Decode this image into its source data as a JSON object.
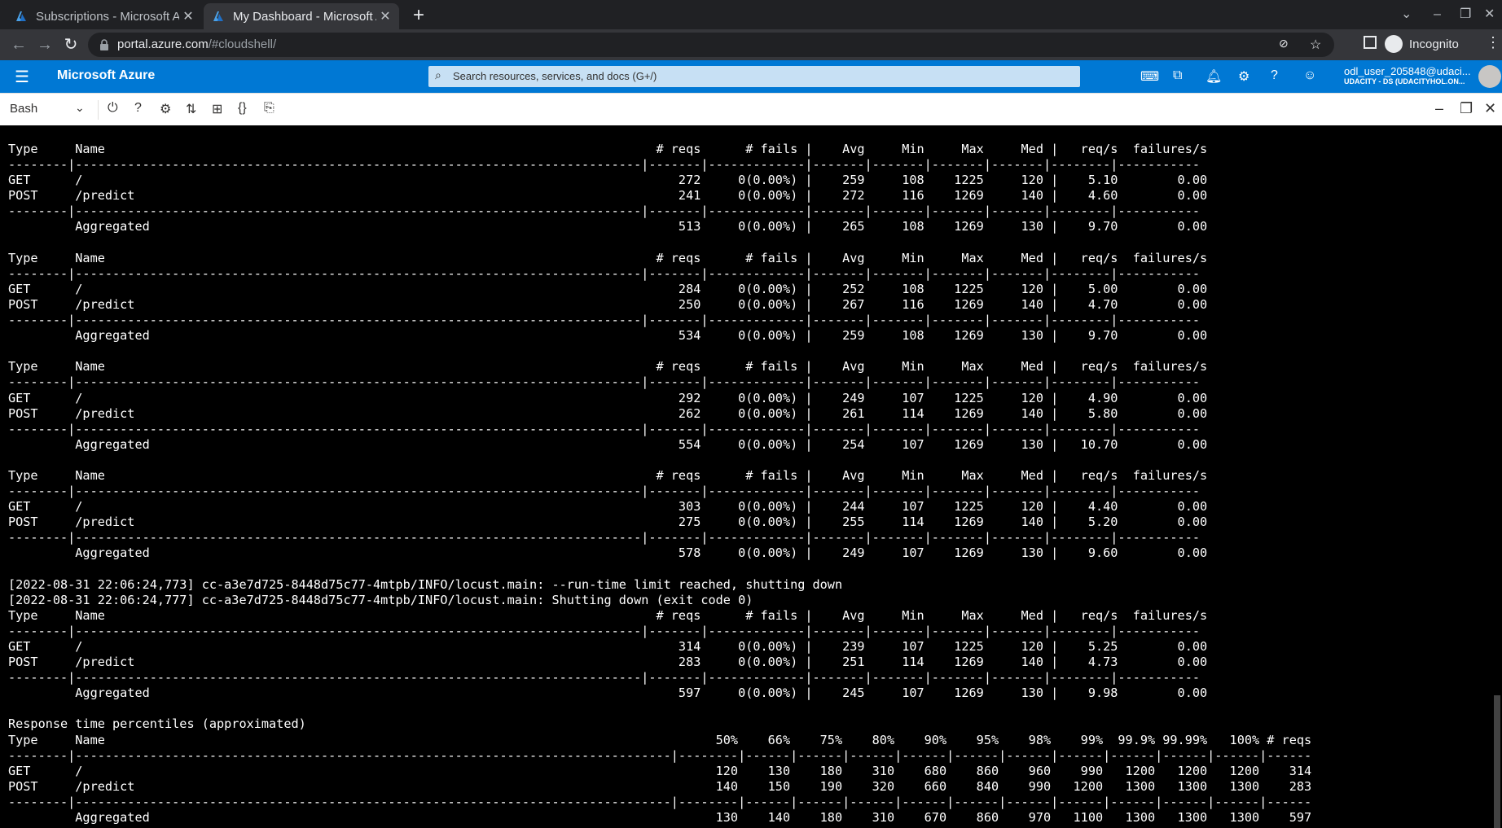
{
  "browser": {
    "tabs": [
      {
        "title": "Subscriptions - Microsoft Azure",
        "active": false
      },
      {
        "title": "My Dashboard - Microsoft Azure",
        "active": true
      }
    ],
    "url_host": "portal.azure.com",
    "url_path": "/#cloudshell/",
    "profile_label": "Incognito"
  },
  "azure": {
    "brand": "Microsoft Azure",
    "search_placeholder": "Search resources, services, and docs (G+/)",
    "user_name": "odl_user_205848@udaci...",
    "user_directory": "UDACITY - DS (UDACITYHOL.ON..."
  },
  "shell": {
    "shell_type": "Bash"
  },
  "terminal": {
    "lines": [
      "Type     Name                                                                          # reqs      # fails |    Avg     Min     Max     Med |   req/s  failures/s",
      "--------|----------------------------------------------------------------------------|-------|-------------|-------|-------|-------|-------|--------|-----------",
      "GET      /                                                                                272     0(0.00%) |    259     108    1225     120 |    5.10        0.00",
      "POST     /predict                                                                         241     0(0.00%) |    272     116    1269     140 |    4.60        0.00",
      "--------|----------------------------------------------------------------------------|-------|-------------|-------|-------|-------|-------|--------|-----------",
      "         Aggregated                                                                       513     0(0.00%) |    265     108    1269     130 |    9.70        0.00",
      "",
      "Type     Name                                                                          # reqs      # fails |    Avg     Min     Max     Med |   req/s  failures/s",
      "--------|----------------------------------------------------------------------------|-------|-------------|-------|-------|-------|-------|--------|-----------",
      "GET      /                                                                                284     0(0.00%) |    252     108    1225     120 |    5.00        0.00",
      "POST     /predict                                                                         250     0(0.00%) |    267     116    1269     140 |    4.70        0.00",
      "--------|----------------------------------------------------------------------------|-------|-------------|-------|-------|-------|-------|--------|-----------",
      "         Aggregated                                                                       534     0(0.00%) |    259     108    1269     130 |    9.70        0.00",
      "",
      "Type     Name                                                                          # reqs      # fails |    Avg     Min     Max     Med |   req/s  failures/s",
      "--------|----------------------------------------------------------------------------|-------|-------------|-------|-------|-------|-------|--------|-----------",
      "GET      /                                                                                292     0(0.00%) |    249     107    1225     120 |    4.90        0.00",
      "POST     /predict                                                                         262     0(0.00%) |    261     114    1269     140 |    5.80        0.00",
      "--------|----------------------------------------------------------------------------|-------|-------------|-------|-------|-------|-------|--------|-----------",
      "         Aggregated                                                                       554     0(0.00%) |    254     107    1269     130 |   10.70        0.00",
      "",
      "Type     Name                                                                          # reqs      # fails |    Avg     Min     Max     Med |   req/s  failures/s",
      "--------|----------------------------------------------------------------------------|-------|-------------|-------|-------|-------|-------|--------|-----------",
      "GET      /                                                                                303     0(0.00%) |    244     107    1225     120 |    4.40        0.00",
      "POST     /predict                                                                         275     0(0.00%) |    255     114    1269     140 |    5.20        0.00",
      "--------|----------------------------------------------------------------------------|-------|-------------|-------|-------|-------|-------|--------|-----------",
      "         Aggregated                                                                       578     0(0.00%) |    249     107    1269     130 |    9.60        0.00",
      "",
      "[2022-08-31 22:06:24,773] cc-a3e7d725-8448d75c77-4mtpb/INFO/locust.main: --run-time limit reached, shutting down",
      "[2022-08-31 22:06:24,777] cc-a3e7d725-8448d75c77-4mtpb/INFO/locust.main: Shutting down (exit code 0)",
      "Type     Name                                                                          # reqs      # fails |    Avg     Min     Max     Med |   req/s  failures/s",
      "--------|----------------------------------------------------------------------------|-------|-------------|-------|-------|-------|-------|--------|-----------",
      "GET      /                                                                                314     0(0.00%) |    239     107    1225     120 |    5.25        0.00",
      "POST     /predict                                                                         283     0(0.00%) |    251     114    1269     140 |    4.73        0.00",
      "--------|----------------------------------------------------------------------------|-------|-------------|-------|-------|-------|-------|--------|-----------",
      "         Aggregated                                                                       597     0(0.00%) |    245     107    1269     130 |    9.98        0.00",
      "",
      "Response time percentiles (approximated)",
      "Type     Name                                                                                  50%    66%    75%    80%    90%    95%    98%    99%  99.9% 99.99%   100% # reqs",
      "--------|--------------------------------------------------------------------------------|--------|------|------|------|------|------|------|------|------|------|------|------",
      "GET      /                                                                                     120    130    180    310    680    860    960    990   1200   1200   1200    314",
      "POST     /predict                                                                              140    150    190    320    660    840    990   1200   1300   1300   1300    283",
      "--------|--------------------------------------------------------------------------------|--------|------|------|------|------|------|------|------|------|------|------|------",
      "         Aggregated                                                                            130    140    180    310    670    860    970   1100   1300   1300   1300    597"
    ]
  }
}
